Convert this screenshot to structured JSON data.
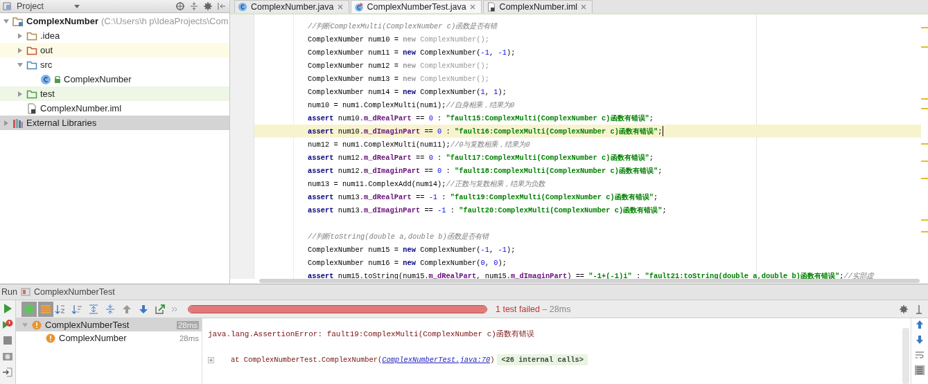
{
  "project_panel": {
    "title": "Project",
    "tree": [
      {
        "label": "ComplexNumber",
        "path": "(C:\\Users\\h p\\IdeaProjects\\Com",
        "kind": "module",
        "expanded": true,
        "selected": false,
        "children": [
          {
            "label": ".idea",
            "kind": "folder",
            "expanded": false,
            "selected": false,
            "color": "#b08a4e"
          },
          {
            "label": "out",
            "kind": "excluded",
            "expanded": false,
            "selected": false,
            "color": "#c0533e"
          },
          {
            "label": "src",
            "kind": "source",
            "expanded": true,
            "selected": false,
            "color": "#4e86b5",
            "children": [
              {
                "label": "ComplexNumber",
                "kind": "class",
                "selected": false
              }
            ]
          },
          {
            "label": "test",
            "kind": "test",
            "expanded": false,
            "selected": false,
            "color": "#4f9a4a"
          },
          {
            "label": "ComplexNumber.iml",
            "kind": "file",
            "selected": false
          }
        ]
      },
      {
        "label": "External Libraries",
        "kind": "libraries",
        "expanded": false,
        "selected": true
      }
    ]
  },
  "editor_tabs": [
    {
      "label": "ComplexNumber.java",
      "kind": "class",
      "selected": false
    },
    {
      "label": "ComplexNumberTest.java",
      "kind": "test",
      "selected": true
    },
    {
      "label": "ComplexNumber.iml",
      "kind": "file",
      "selected": false
    }
  ],
  "code_lines": [
    {
      "current": false,
      "tokens": [
        {
          "kind": "comment",
          "text": "//判断ComplexMulti(ComplexNumber c)函数是否有错"
        }
      ]
    },
    {
      "current": false,
      "tokens": [
        {
          "kind": "plain",
          "text": "ComplexNumber num10 = "
        },
        {
          "kind": "unused_keyword",
          "text": "new"
        },
        {
          "kind": "unused",
          "text": " ComplexNumber();"
        }
      ]
    },
    {
      "current": false,
      "tokens": [
        {
          "kind": "plain",
          "text": "ComplexNumber num11 = "
        },
        {
          "kind": "keyword",
          "text": "new"
        },
        {
          "kind": "plain",
          "text": " ComplexNumber("
        },
        {
          "kind": "number",
          "text": "-1"
        },
        {
          "kind": "plain",
          "text": ", "
        },
        {
          "kind": "number",
          "text": "-1"
        },
        {
          "kind": "plain",
          "text": ");"
        }
      ]
    },
    {
      "current": false,
      "tokens": [
        {
          "kind": "plain",
          "text": "ComplexNumber num12 = "
        },
        {
          "kind": "unused_keyword",
          "text": "new"
        },
        {
          "kind": "unused",
          "text": " ComplexNumber();"
        }
      ]
    },
    {
      "current": false,
      "tokens": [
        {
          "kind": "plain",
          "text": "ComplexNumber num13 = "
        },
        {
          "kind": "unused_keyword",
          "text": "new"
        },
        {
          "kind": "unused",
          "text": " ComplexNumber();"
        }
      ]
    },
    {
      "current": false,
      "tokens": [
        {
          "kind": "plain",
          "text": "ComplexNumber num14 = "
        },
        {
          "kind": "keyword",
          "text": "new"
        },
        {
          "kind": "plain",
          "text": " ComplexNumber("
        },
        {
          "kind": "number",
          "text": "1"
        },
        {
          "kind": "plain",
          "text": ", "
        },
        {
          "kind": "number",
          "text": "1"
        },
        {
          "kind": "plain",
          "text": ");"
        }
      ]
    },
    {
      "current": false,
      "tokens": [
        {
          "kind": "plain",
          "text": "num10 = num1.ComplexMulti(num1);"
        },
        {
          "kind": "comment",
          "text": "//自身相乘，结果为0"
        }
      ]
    },
    {
      "current": false,
      "tokens": [
        {
          "kind": "keyword",
          "text": "assert"
        },
        {
          "kind": "plain",
          "text": " num10."
        },
        {
          "kind": "field",
          "text": "m_dRealPart"
        },
        {
          "kind": "plain",
          "text": " == "
        },
        {
          "kind": "number",
          "text": "0"
        },
        {
          "kind": "plain",
          "text": " : "
        },
        {
          "kind": "string",
          "text": "\"fault15:ComplexMulti(ComplexNumber c)函数有错误\""
        },
        {
          "kind": "plain",
          "text": ";"
        }
      ]
    },
    {
      "current": true,
      "tokens": [
        {
          "kind": "keyword",
          "text": "assert"
        },
        {
          "kind": "plain",
          "text": " num10."
        },
        {
          "kind": "field",
          "text": "m_dImaginPart"
        },
        {
          "kind": "plain",
          "text": " == "
        },
        {
          "kind": "number",
          "text": "0"
        },
        {
          "kind": "plain",
          "text": " : "
        },
        {
          "kind": "string",
          "text": "\"fault16:ComplexMulti(ComplexNumber c)函数有错误\""
        },
        {
          "kind": "plain",
          "text": ";"
        }
      ]
    },
    {
      "current": false,
      "tokens": [
        {
          "kind": "plain",
          "text": "num12 = num1.ComplexMulti(num11);"
        },
        {
          "kind": "comment",
          "text": "//0与复数相乘，结果为0"
        }
      ]
    },
    {
      "current": false,
      "tokens": [
        {
          "kind": "keyword",
          "text": "assert"
        },
        {
          "kind": "plain",
          "text": " num12."
        },
        {
          "kind": "field",
          "text": "m_dRealPart"
        },
        {
          "kind": "plain",
          "text": " == "
        },
        {
          "kind": "number",
          "text": "0"
        },
        {
          "kind": "plain",
          "text": " : "
        },
        {
          "kind": "string",
          "text": "\"fault17:ComplexMulti(ComplexNumber c)函数有错误\""
        },
        {
          "kind": "plain",
          "text": ";"
        }
      ]
    },
    {
      "current": false,
      "tokens": [
        {
          "kind": "keyword",
          "text": "assert"
        },
        {
          "kind": "plain",
          "text": " num12."
        },
        {
          "kind": "field",
          "text": "m_dImaginPart"
        },
        {
          "kind": "plain",
          "text": " == "
        },
        {
          "kind": "number",
          "text": "0"
        },
        {
          "kind": "plain",
          "text": " : "
        },
        {
          "kind": "string",
          "text": "\"fault18:ComplexMulti(ComplexNumber c)函数有错误\""
        },
        {
          "kind": "plain",
          "text": ";"
        }
      ]
    },
    {
      "current": false,
      "tokens": [
        {
          "kind": "plain",
          "text": "num13 = num11.ComplexAdd(num14);"
        },
        {
          "kind": "comment",
          "text": "//正数与复数相乘，结果为负数"
        }
      ]
    },
    {
      "current": false,
      "tokens": [
        {
          "kind": "keyword",
          "text": "assert"
        },
        {
          "kind": "plain",
          "text": " num13."
        },
        {
          "kind": "field",
          "text": "m_dRealPart"
        },
        {
          "kind": "plain",
          "text": " == "
        },
        {
          "kind": "number",
          "text": "-1"
        },
        {
          "kind": "plain",
          "text": " : "
        },
        {
          "kind": "string",
          "text": "\"fault19:ComplexMulti(ComplexNumber c)函数有错误\""
        },
        {
          "kind": "plain",
          "text": ";"
        }
      ]
    },
    {
      "current": false,
      "tokens": [
        {
          "kind": "keyword",
          "text": "assert"
        },
        {
          "kind": "plain",
          "text": " num13."
        },
        {
          "kind": "field",
          "text": "m_dImaginPart"
        },
        {
          "kind": "plain",
          "text": " == "
        },
        {
          "kind": "number",
          "text": "-1"
        },
        {
          "kind": "plain",
          "text": " : "
        },
        {
          "kind": "string",
          "text": "\"fault20:ComplexMulti(ComplexNumber c)函数有错误\""
        },
        {
          "kind": "plain",
          "text": ";"
        }
      ]
    },
    {
      "current": false
    },
    {
      "current": false,
      "tokens": [
        {
          "kind": "comment",
          "text": "//判断toString(double a,double b)函数是否有错"
        }
      ]
    },
    {
      "current": false,
      "tokens": [
        {
          "kind": "plain",
          "text": "ComplexNumber num15 = "
        },
        {
          "kind": "keyword",
          "text": "new"
        },
        {
          "kind": "plain",
          "text": " ComplexNumber("
        },
        {
          "kind": "number",
          "text": "-1"
        },
        {
          "kind": "plain",
          "text": ", "
        },
        {
          "kind": "number",
          "text": "-1"
        },
        {
          "kind": "plain",
          "text": ");"
        }
      ]
    },
    {
      "current": false,
      "tokens": [
        {
          "kind": "plain",
          "text": "ComplexNumber num16 = "
        },
        {
          "kind": "keyword",
          "text": "new"
        },
        {
          "kind": "plain",
          "text": " ComplexNumber("
        },
        {
          "kind": "number",
          "text": "0"
        },
        {
          "kind": "plain",
          "text": ", "
        },
        {
          "kind": "number",
          "text": "0"
        },
        {
          "kind": "plain",
          "text": ");"
        }
      ]
    },
    {
      "current": false,
      "tokens": [
        {
          "kind": "keyword",
          "text": "assert"
        },
        {
          "kind": "plain",
          "text": " num15.toString(num15."
        },
        {
          "kind": "field",
          "text": "m_dRealPart"
        },
        {
          "kind": "plain",
          "text": ", num15."
        },
        {
          "kind": "field",
          "text": "m_dImaginPart"
        },
        {
          "kind": "plain",
          "text": ") == "
        },
        {
          "kind": "string",
          "text": "\"-1+(-1)i\""
        },
        {
          "kind": "plain",
          "text": " : "
        },
        {
          "kind": "string",
          "text": "\"fault21:toString(double a,double b)函数有错误\""
        },
        {
          "kind": "plain",
          "text": ";"
        },
        {
          "kind": "comment",
          "text": "//实部虚"
        }
      ]
    }
  ],
  "run_panel": {
    "title": "Run",
    "configuration": "ComplexNumberTest",
    "progress": {
      "level": 1.0,
      "failed": true
    },
    "status": "1 test failed",
    "duration": " – 28ms",
    "tests": [
      {
        "label": "ComplexNumberTest",
        "time": "28ms",
        "selected": true,
        "expanded": true,
        "children": [
          {
            "label": "ComplexNumber",
            "time": "28ms",
            "selected": false
          }
        ]
      }
    ],
    "output": {
      "error": "java.lang.AssertionError: fault19:ComplexMulti(ComplexNumber c)函数有错误",
      "trace_prefix": "at ComplexNumberTest.ComplexNumber(",
      "trace_link": "ComplexNumberTest.java:70",
      "trace_suffix": ")",
      "internal_calls": "<26 internal calls>"
    }
  }
}
